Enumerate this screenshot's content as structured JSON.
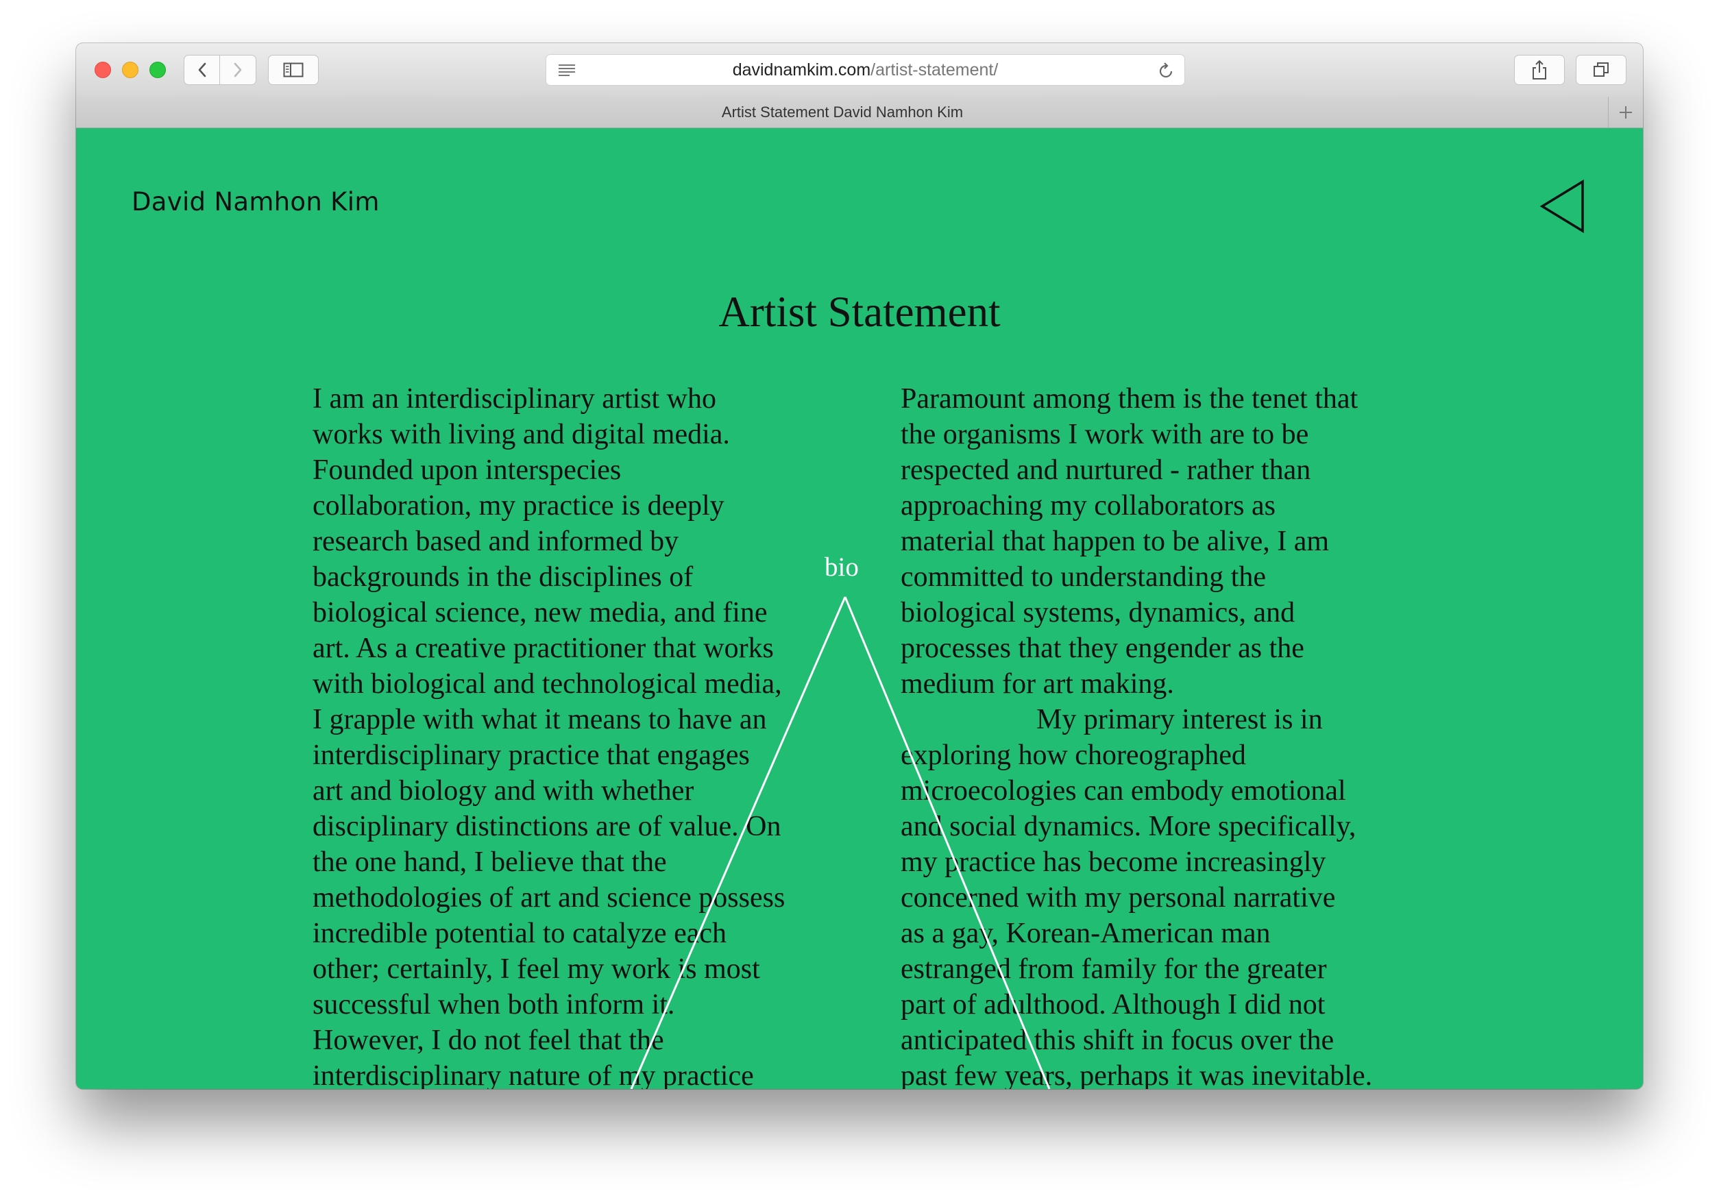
{
  "browser": {
    "url_domain": "davidnamkim.com",
    "url_path": "/artist-statement/",
    "tab_title": "Artist Statement David Namhon Kim"
  },
  "site": {
    "name": "David Namhon Kim"
  },
  "page": {
    "title": "Artist Statement",
    "bio_link": "bio",
    "column1_lines": [
      "I am an interdisciplinary artist who",
      "works with living and digital media.",
      "Founded upon interspecies",
      "collaboration, my practice is deeply",
      "research based and informed by",
      "backgrounds in the disciplines of",
      "biological science, new media, and fine",
      "art. As a creative practitioner that works",
      "with biological and technological media,",
      "I grapple with what it means to have an",
      "interdisciplinary practice that engages",
      "art and biology and with whether",
      "disciplinary distinctions are of value. On",
      "the one hand, I believe that the",
      "methodologies of art and science possess",
      "incredible potential to catalyze each",
      "other; certainly, I feel my work is most",
      "successful when both inform it.",
      "However, I do not feel that the",
      "interdisciplinary nature of my practice"
    ],
    "column2_lines": [
      "Paramount among them is the tenet that",
      "the organisms I work with are to be",
      "respected and nurtured - rather than",
      "approaching my collaborators as",
      "material that happen to be alive, I am",
      "committed to understanding the",
      "biological systems, dynamics, and",
      "processes that they engender as the",
      "medium for art making."
    ],
    "column2_para2_lines": [
      "My primary interest is in",
      "exploring how choreographed",
      "microecologies can embody emotional",
      "and social dynamics. More specifically,",
      "my practice has become increasingly",
      "concerned with my personal narrative",
      "as a gay, Korean-American man",
      "estranged from family for the greater",
      "part of adulthood. Although I did not",
      "anticipated this shift in focus over the",
      "past few years, perhaps it was inevitable."
    ]
  },
  "colors": {
    "background": "#21bd73",
    "text": "#111111",
    "accent_line": "#ffffff"
  },
  "icons": [
    "back-chevron-icon",
    "forward-chevron-icon",
    "sidebar-icon",
    "reader-icon",
    "reload-icon",
    "share-icon",
    "tabs-overview-icon",
    "new-tab-plus-icon",
    "back-triangle-icon"
  ]
}
